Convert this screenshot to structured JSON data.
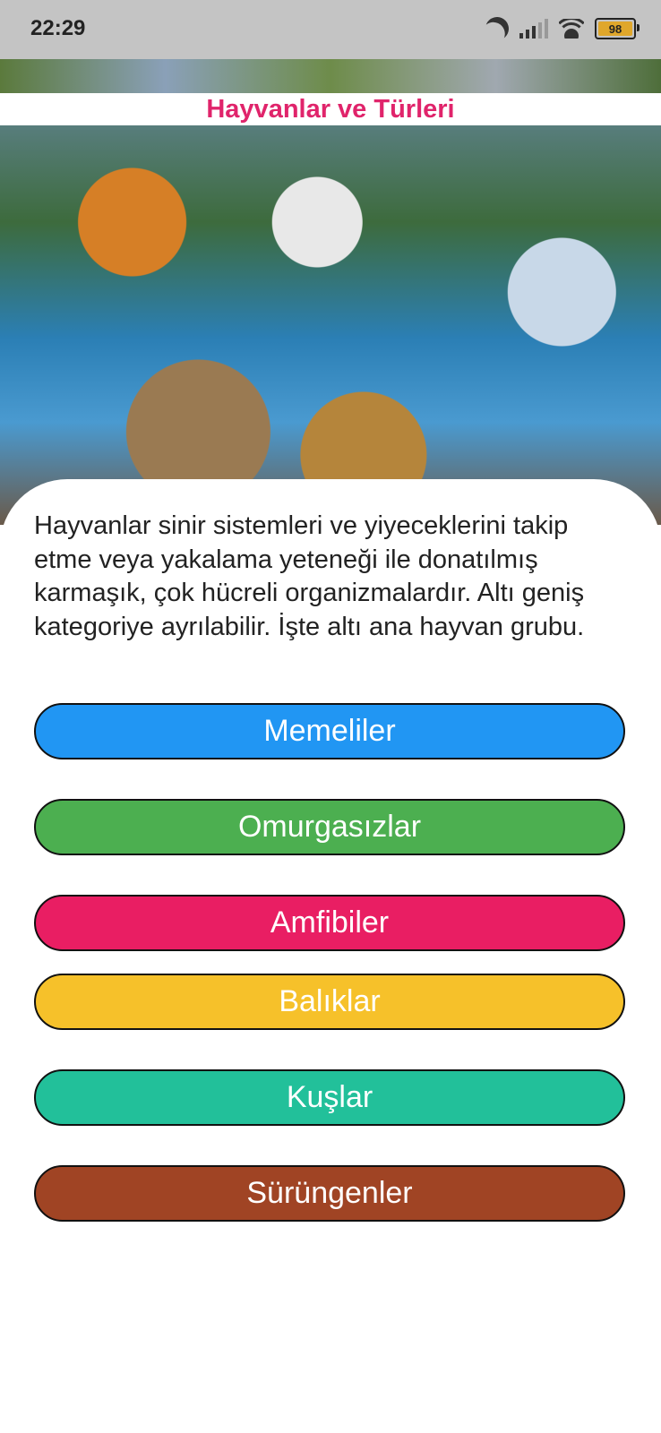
{
  "status_bar": {
    "time": "22:29",
    "battery_level": "98",
    "icons": [
      "moon-icon",
      "signal-icon",
      "wifi-icon",
      "battery-icon"
    ]
  },
  "header": {
    "title": "Hayvanlar ve Türleri",
    "title_color": "#e0246b"
  },
  "hero_image": {
    "description_icon": "animals-collage-image"
  },
  "intro": {
    "text": "Hayvanlar sinir sistemleri ve yiyeceklerini takip etme veya yakalama yeteneği ile donatılmış karmaşık, çok hücreli organizmalardır. Altı geniş kategoriye ayrılabilir. İşte altı ana hayvan grubu."
  },
  "categories": [
    {
      "label": "Memeliler",
      "color": "#2196f3"
    },
    {
      "label": "Omurgasızlar",
      "color": "#4caf50"
    },
    {
      "label": "Amfibiler",
      "color": "#e91e63"
    },
    {
      "label": "Balıklar",
      "color": "#f6c12a"
    },
    {
      "label": "Kuşlar",
      "color": "#22c09a"
    },
    {
      "label": "Sürüngenler",
      "color": "#a04424"
    }
  ]
}
